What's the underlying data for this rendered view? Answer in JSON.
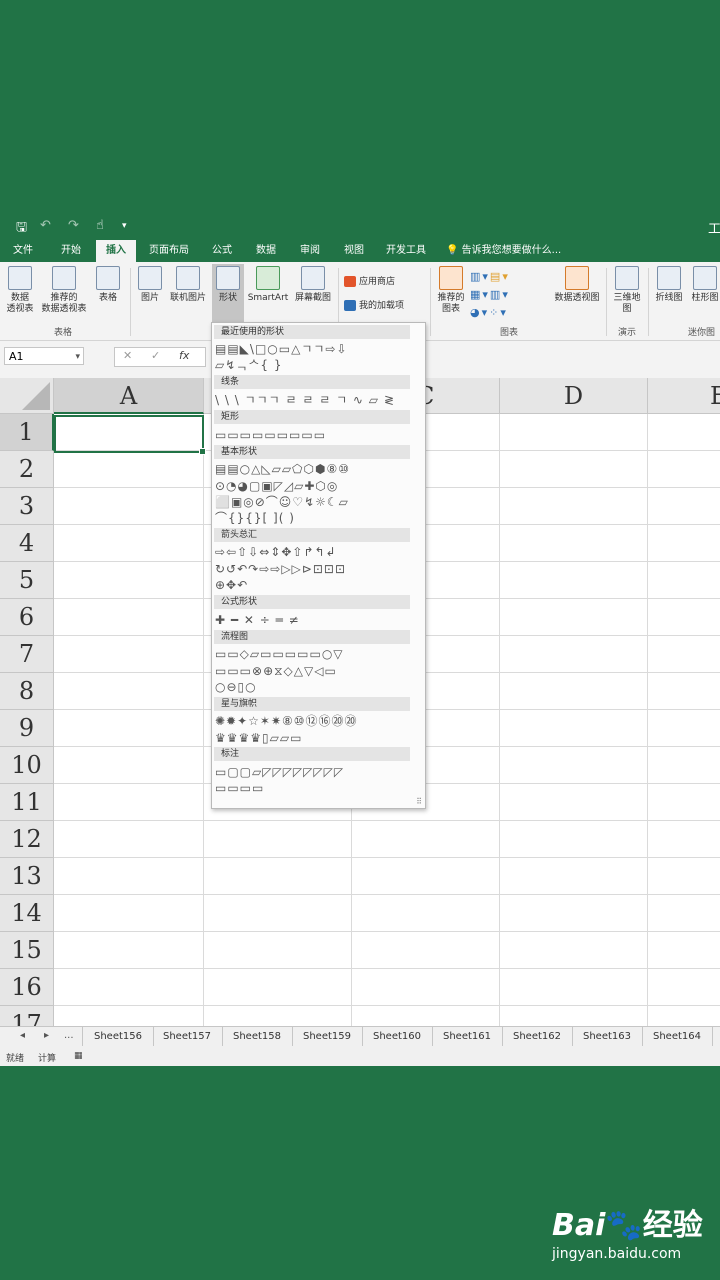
{
  "qat": {
    "save": "🖫",
    "undo": "↶",
    "redo": "↷",
    "touch": "☝",
    "more": "▾",
    "app_initial": "工"
  },
  "tabs": [
    "文件",
    "开始",
    "插入",
    "页面布局",
    "公式",
    "数据",
    "审阅",
    "视图",
    "开发工具"
  ],
  "active_tab": "插入",
  "tell_me": "告诉我您想要做什么...",
  "ribbon": {
    "pivot": "数据\n透视表",
    "rec_pivot": "推荐的\n数据透视表",
    "table": "表格",
    "picture": "图片",
    "online_pic": "联机图片",
    "shapes": "形状",
    "smartart": "SmartArt",
    "screenshot": "屏幕截图",
    "store": "应用商店",
    "my_addins": "我的加载项",
    "rec_charts": "推荐的\n图表",
    "pivot_chart": "数据透视图",
    "map3d": "三维地\n图",
    "line": "折线图",
    "column": "柱形图",
    "group_tables": "表格",
    "group_charts": "图表",
    "group_tours": "演示",
    "group_spark": "迷你图"
  },
  "formula": {
    "namebox": "A1",
    "cancel": "✕",
    "enter": "✓",
    "fx": "fx"
  },
  "columns": [
    "A",
    "",
    "C",
    "D",
    "E"
  ],
  "rows": [
    "1",
    "2",
    "3",
    "4",
    "5",
    "6",
    "7",
    "8",
    "9",
    "10",
    "11",
    "12",
    "13",
    "14",
    "15",
    "16",
    "17"
  ],
  "sheet_nav": [
    "◂",
    "▸",
    "..."
  ],
  "sheets": [
    "Sheet156",
    "Sheet157",
    "Sheet158",
    "Sheet159",
    "Sheet160",
    "Sheet161",
    "Sheet162",
    "Sheet163",
    "Sheet164"
  ],
  "status": {
    "ready": "就绪",
    "calc": "计算",
    "icon": "▦"
  },
  "shapes_menu": {
    "recent": "最近使用的形状",
    "lines": "线条",
    "rect": "矩形",
    "basic": "基本形状",
    "arrows": "箭头总汇",
    "equation": "公式形状",
    "flowchart": "流程图",
    "stars": "星与旗帜",
    "callouts": "标注",
    "recent_row1": "▤▤◣\\□○▭△ㄱㄱ⇨⇩",
    "recent_row2": "▱↯ᆨᄉ{ }",
    "lines_row": "\\ \\ \\ ㄱㄱㄱ ㄹ ㄹ ㄹ ㄱ ∿ ▱ ≷",
    "rect_row": "▭▭▭▭▭▭▭▭▭",
    "basic_row1": "▤▤○△◺▱▱⬠⬡⬢⑧⑩",
    "basic_row2": "⊙◔◕▢▣◸◿▱✚⬡◎",
    "basic_row3": "⬜▣◎⊘⌒☺♡↯☼☾▱",
    "basic_row4": "⌒{}{}[ ]( )",
    "arrows_row1": "⇨⇦⇧⇩⇔⇕✥⇧↱↰↲",
    "arrows_row2": "↻↺↶↷⇨⇨▷▷⊳⊡⊡⊡",
    "arrows_row3": "⊕✥↶",
    "eq_row": "✚ ━ ✕ ÷ ═ ≠",
    "flow_row1": "▭▭◇▱▭▭▭▭▭○▽",
    "flow_row2": "▭▭▭⊗⊕⧖◇△▽◁▭",
    "flow_row3": "○⊖▯○",
    "stars_row1": "✺✹✦☆✶✷⑧⑩⑫⑯⑳⑳",
    "stars_row2": "♛♛♛♛▯▱▱▭",
    "callout_row1": "▭▢▢▱◸◸◸◸◸◸◸◸",
    "callout_row2": "▭▭▭▭",
    "grip": "⠿"
  },
  "watermark": {
    "logo": "Bai",
    "paw": "🐾",
    "brand": "经验",
    "url": "jingyan.baidu.com"
  }
}
